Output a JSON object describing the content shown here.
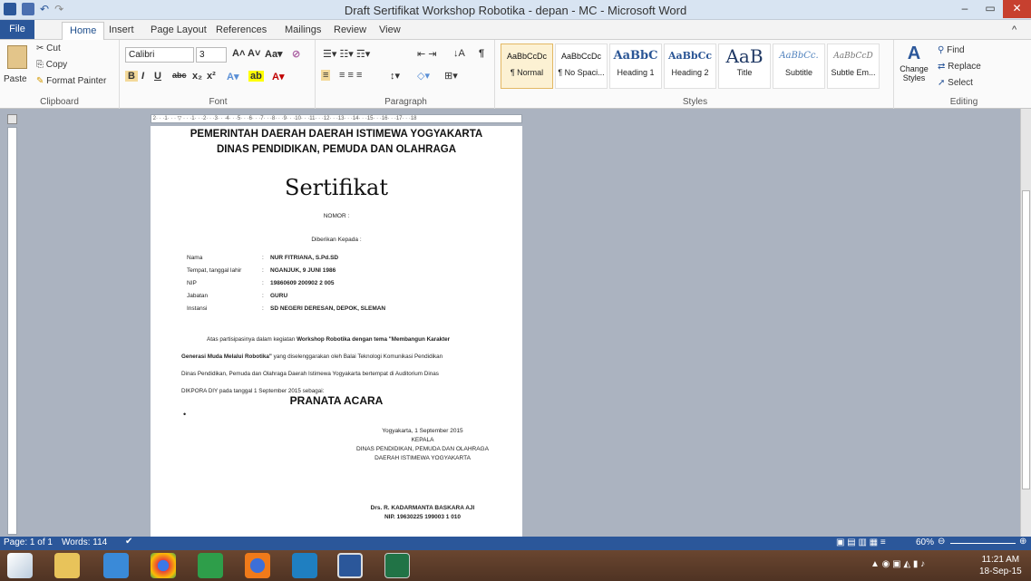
{
  "window": {
    "title": "Draft Sertifikat Workshop Robotika - depan - MC - Microsoft Word",
    "minimize": "–",
    "restore": "▭",
    "close": "✕"
  },
  "tabs": [
    "File",
    "Home",
    "Insert",
    "Page Layout",
    "References",
    "Mailings",
    "Review",
    "View"
  ],
  "clipboard": {
    "paste": "Paste",
    "cut": "Cut",
    "copy": "Copy",
    "format_painter": "Format Painter",
    "label": "Clipboard"
  },
  "font": {
    "name": "Calibri",
    "size": "3",
    "label": "Font"
  },
  "paragraph": {
    "label": "Paragraph"
  },
  "styles": {
    "items": [
      {
        "preview": "AaBbCcDc",
        "name": "¶ Normal"
      },
      {
        "preview": "AaBbCcDc",
        "name": "¶ No Spaci..."
      },
      {
        "preview": "AaBbC",
        "name": "Heading 1"
      },
      {
        "preview": "AaBbCc",
        "name": "Heading 2"
      },
      {
        "preview": "AaB",
        "name": "Title"
      },
      {
        "preview": "AaBbCc.",
        "name": "Subtitle"
      },
      {
        "preview": "AaBbCcD",
        "name": "Subtle Em..."
      }
    ],
    "change": "Change Styles",
    "label": "Styles"
  },
  "editing": {
    "find": "Find",
    "replace": "Replace",
    "select": "Select",
    "label": "Editing"
  },
  "document": {
    "header1": "PEMERINTAH DAERAH DAERAH ISTIMEWA YOGYAKARTA",
    "header2": "DINAS PENDIDIKAN, PEMUDA DAN OLAHRAGA",
    "title": "Sertifikat",
    "nomor": "NOMOR :",
    "given": "Diberikan Kepada :",
    "fields": [
      {
        "label": "Nama",
        "value": "NUR FITRIANA, S.Pd.SD"
      },
      {
        "label": "Tempat, tanggal lahir",
        "value": "NGANJUK, 9 JUNI 1986"
      },
      {
        "label": "NIP",
        "value": "19860609 200902 2 005"
      },
      {
        "label": "Jabatan",
        "value": "GURU"
      },
      {
        "label": "Instansi",
        "value": "SD NEGERI DERESAN, DEPOK, SLEMAN"
      }
    ],
    "para": {
      "l1_pre": "Atas partisipasinya dalam kegiatan ",
      "l1_bold": "Workshop Robotika dengan tema \"Membangun Karakter",
      "l2_bold": "Generasi Muda Melalui Robotika\"",
      "l2_post": " yang diselenggarakan oleh Balai Teknologi Komunikasi Pendidikan",
      "l3": "Dinas Pendidikan, Pemuda dan Olahraga Daerah Istimewa Yogyakarta bertempat di Auditorium Dinas",
      "l4": "DIKPORA DIY pada tanggal 1 September 2015 sebagai:"
    },
    "acara": "PRANATA ACARA",
    "bullet": "•",
    "sig": {
      "place_date": "Yogyakarta, 1 September 2015",
      "role": "KEPALA",
      "org1": "DINAS PENDIDIKAN, PEMUDA DAN OLAHRAGA",
      "org2": "DAERAH ISTIMEWA YOGYAKARTA",
      "name": "Drs. R. KADARMANTA BASKARA AJI",
      "nip": "NIP. 19630225 199003 1 010"
    }
  },
  "status": {
    "page": "Page: 1 of 1",
    "words": "Words: 114",
    "zoom": "60%"
  },
  "clock": {
    "time": "11:21 AM",
    "date": "18-Sep-15"
  }
}
